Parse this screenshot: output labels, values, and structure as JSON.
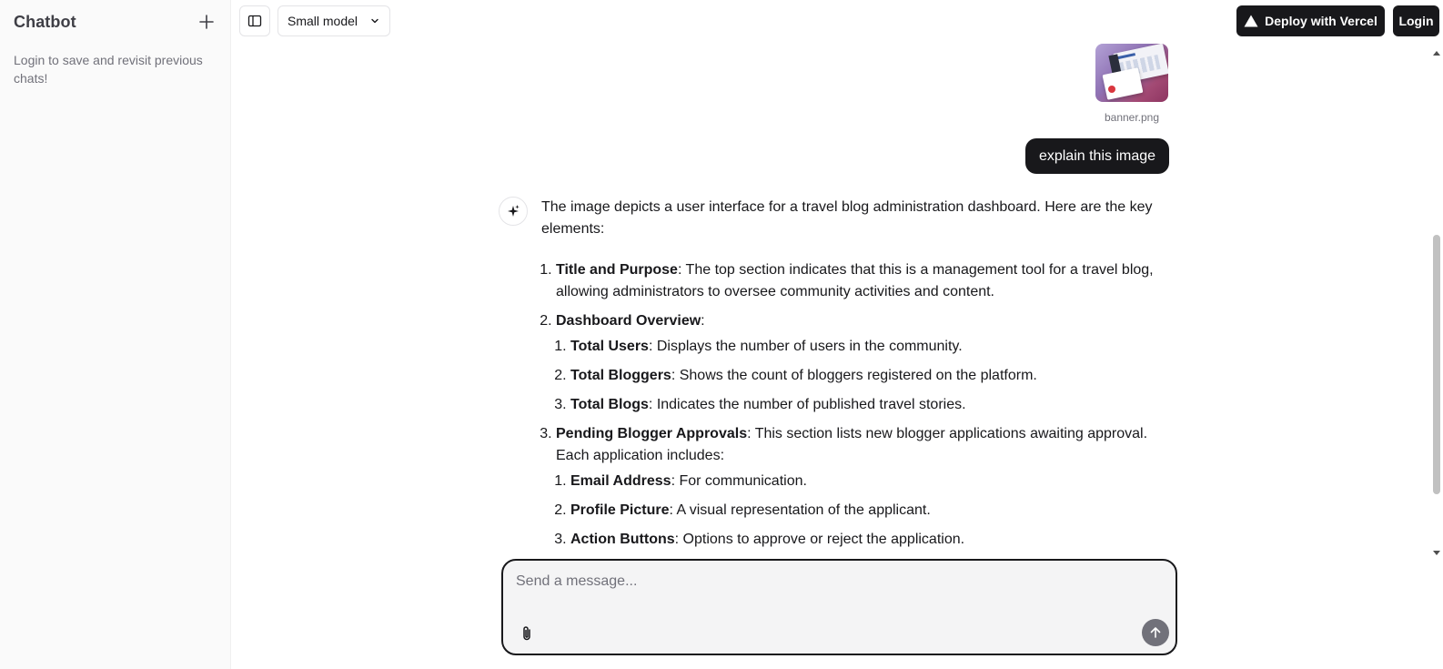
{
  "sidebar": {
    "title": "Chatbot",
    "new_chat_icon": "plus-icon",
    "note": "Login to save and revisit previous chats!"
  },
  "header": {
    "sidebar_toggle_icon": "sidebar-toggle-icon",
    "model_label": "Small model",
    "deploy_label": "Deploy with Vercel",
    "login_label": "Login"
  },
  "conversation": {
    "attachment": {
      "file_name": "banner.png"
    },
    "user_message": "explain this image",
    "assistant": {
      "intro": "The image depicts a user interface for a travel blog administration dashboard. Here are the key elements:",
      "sections": [
        {
          "heading": "Title and Purpose",
          "text": ": The top section indicates that this is a management tool for a travel blog, allowing administrators to oversee community activities and content."
        },
        {
          "heading": "Dashboard Overview",
          "text": ":",
          "items": [
            {
              "heading": "Total Users",
              "text": ": Displays the number of users in the community."
            },
            {
              "heading": "Total Bloggers",
              "text": ": Shows the count of bloggers registered on the platform."
            },
            {
              "heading": "Total Blogs",
              "text": ": Indicates the number of published travel stories."
            }
          ]
        },
        {
          "heading": "Pending Blogger Approvals",
          "text": ": This section lists new blogger applications awaiting approval. Each application includes:",
          "items": [
            {
              "heading": "Email Address",
              "text": ": For communication."
            },
            {
              "heading": "Profile Picture",
              "text": ": A visual representation of the applicant."
            },
            {
              "heading": "Action Buttons",
              "text": ": Options to approve or reject the application."
            }
          ]
        }
      ]
    }
  },
  "composer": {
    "placeholder": "Send a message...",
    "value": "",
    "attach_icon": "paperclip-icon",
    "send_icon": "arrow-up-icon"
  },
  "colors": {
    "primary": "#18181b",
    "sidebar_bg": "#fafafa",
    "composer_bg": "#f4f4f5",
    "muted_text": "#71717a"
  }
}
